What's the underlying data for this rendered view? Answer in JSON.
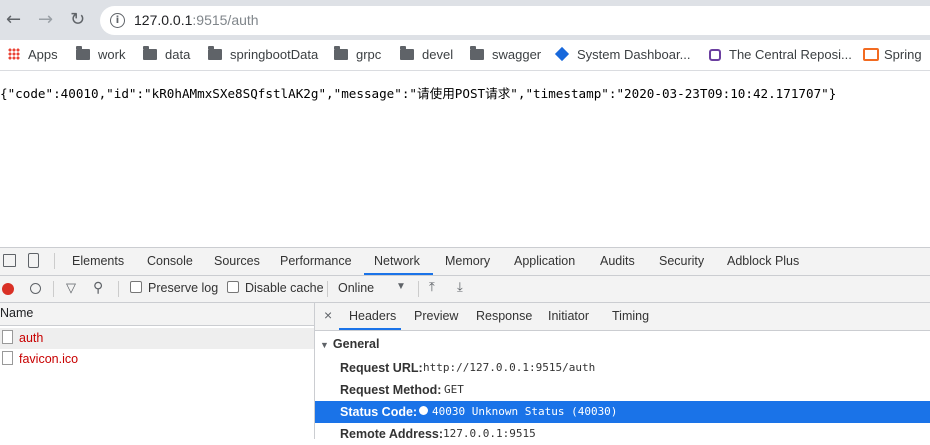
{
  "browser": {
    "url_host": "127.0.0.1",
    "url_rest": ":9515/auth",
    "bookmarks": [
      "Apps",
      "work",
      "data",
      "springbootData",
      "grpc",
      "devel",
      "swagger",
      "System Dashboar...",
      "The Central Reposi...",
      "Spring"
    ]
  },
  "page": {
    "json_text": "{\"code\":40010,\"id\":\"kR0hAMmxSXe8SQfstlAK2g\",\"message\":\"请使用POST请求\",\"timestamp\":\"2020-03-23T09:10:42.171707\"}"
  },
  "devtools": {
    "tabs": [
      "Elements",
      "Console",
      "Sources",
      "Performance",
      "Network",
      "Memory",
      "Application",
      "Audits",
      "Security",
      "Adblock Plus"
    ],
    "active_tab": "Network",
    "toolbar": {
      "preserve_log": "Preserve log",
      "disable_cache": "Disable cache",
      "throttle": "Online"
    },
    "list_header": "Name",
    "requests": [
      "auth",
      "favicon.ico"
    ],
    "detail_tabs": [
      "Headers",
      "Preview",
      "Response",
      "Initiator",
      "Timing"
    ],
    "active_detail_tab": "Headers",
    "section": "General",
    "general": [
      {
        "key": "Request URL:",
        "value": "http://127.0.0.1:9515/auth"
      },
      {
        "key": "Request Method:",
        "value": "GET"
      },
      {
        "key": "Status Code:",
        "value": "40030 Unknown Status (40030)"
      },
      {
        "key": "Remote Address:",
        "value": "127.0.0.1:9515"
      }
    ],
    "accent": "#1a73e8",
    "error_color": "#c80000"
  }
}
